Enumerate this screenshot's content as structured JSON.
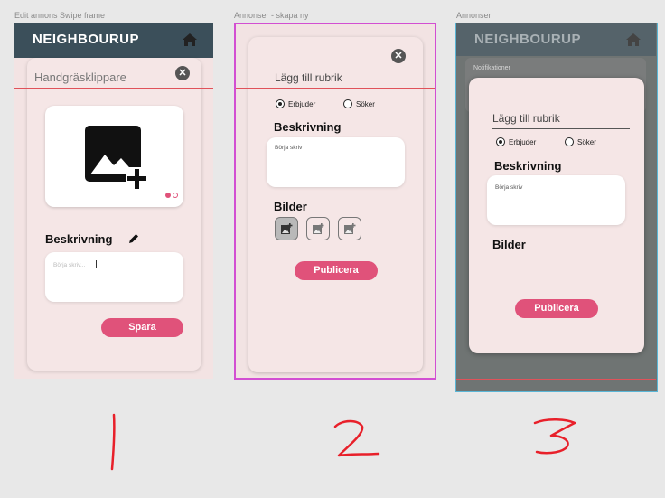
{
  "labels": {
    "frame1": "Edit annons Swipe frame",
    "frame2": "Annonser - skapa ny",
    "frame3": "Annonser"
  },
  "frame1": {
    "logo": "NEIGHBOURUP",
    "title_input": "Handgräsklippare",
    "description_heading": "Beskrivning",
    "description_placeholder": "Börja skriv...",
    "save_button": "Spara"
  },
  "frame2": {
    "title_placeholder": "Lägg till rubrik",
    "radio_offer": "Erbjuder",
    "radio_seek": "Söker",
    "description_heading": "Beskrivning",
    "description_placeholder": "Börja skriv",
    "images_heading": "Bilder",
    "publish_button": "Publicera"
  },
  "frame3": {
    "logo": "NEIGHBOURUP",
    "notifications": "Notifikationer",
    "title_placeholder": "Lägg till rubrik",
    "radio_offer": "Erbjuder",
    "radio_seek": "Söker",
    "description_heading": "Beskrivning",
    "description_placeholder": "Börja skriv",
    "images_heading": "Bilder",
    "publish_button": "Publicera"
  },
  "annotations": [
    "1",
    "2",
    "3"
  ],
  "colors": {
    "accent": "#e0527a",
    "header": "#3b4f5a",
    "card": "#f5e6e6",
    "frame2_border": "#d24fd2",
    "frame3_border": "#5ab6d6",
    "annotation": "#e8202a"
  }
}
